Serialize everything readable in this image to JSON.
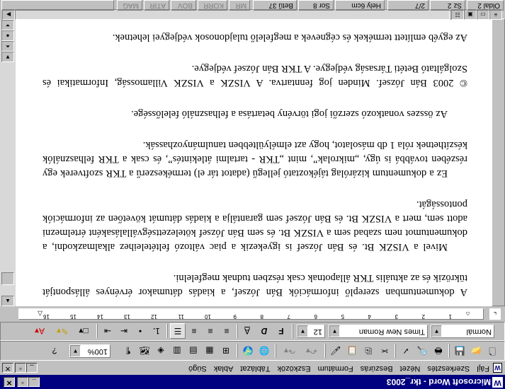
{
  "window": {
    "title": "Microsoft Word - tkr_2003",
    "app_icon": "W"
  },
  "menu": {
    "doc_icon": "W",
    "items": [
      "Fájl",
      "Szerkesztés",
      "Nézet",
      "Beszúrás",
      "Formátum",
      "Eszközök",
      "Táblázat",
      "Ablak",
      "Súgó"
    ]
  },
  "standard_toolbar": {
    "zoom": "100%"
  },
  "formatting_toolbar": {
    "style": "Normál",
    "font": "Times New Roman",
    "size": "12",
    "bold": "F",
    "italic": "D",
    "underline": "A"
  },
  "ruler": {
    "ticks": [
      "1",
      "2",
      "3",
      "4",
      "5",
      "6",
      "7",
      "8",
      "9",
      "10",
      "11",
      "12",
      "13",
      "14",
      "15",
      "16"
    ]
  },
  "document": {
    "paragraphs": [
      "A dokumentumban szereplő információk Bán József, a kiadás dátumakor érvényes álláspontját tükrözik és az aktuális TKR állapotnak csak részben tudnak megfelelni.",
      "Mivel a VISZK Bt. és Bán József is igyekezik a piac változó feltételeihez alkalmazkodni, a dokumentumot nem szabad sem a VISZK Bt. és sem Bán József kötelezettségvállalásaként értelmezni adott sem, mert a VISZK Bt. és Bán József sem garantálja a kiadás dátumát követően az információk pontosságát.",
      "Ez a dokumentum kizárólag tájékoztató jellegű (adatot tár el) termékeszerű a TKR szoftverek egy részében továbbá is úgy, „mikrolak”, mint „TKR - tartalmi átlekintés”, és csak a TKR felhasználók készíthetnek róla 1 db másolatot, hogy azt elmélyültebben tanulmányozhassák.",
      "Az összes vonatkozó szerzői jogi törvény betartása a felhasználó felelőssége.",
      "© 2003 Bán József. Minden jog fenntartva. A VISZK a VISZK Villamosság, Informatikai és Szolgáltató Betéti Társaság védjegye. A TKR Bán József védjegye.",
      "Az egyéb említett termékek és cégnevek a megfelelő tulajdonosok védjegyei lehetnek."
    ]
  },
  "statusbar": {
    "page": "Oldal 2",
    "section": "Sz 2",
    "count": "2/7",
    "position": "Hely 6cm",
    "line": "Sor 8",
    "column": "Betű 37",
    "modes": [
      "MR",
      "KORR",
      "BOV",
      "ÁTÍR",
      "MAG"
    ]
  }
}
